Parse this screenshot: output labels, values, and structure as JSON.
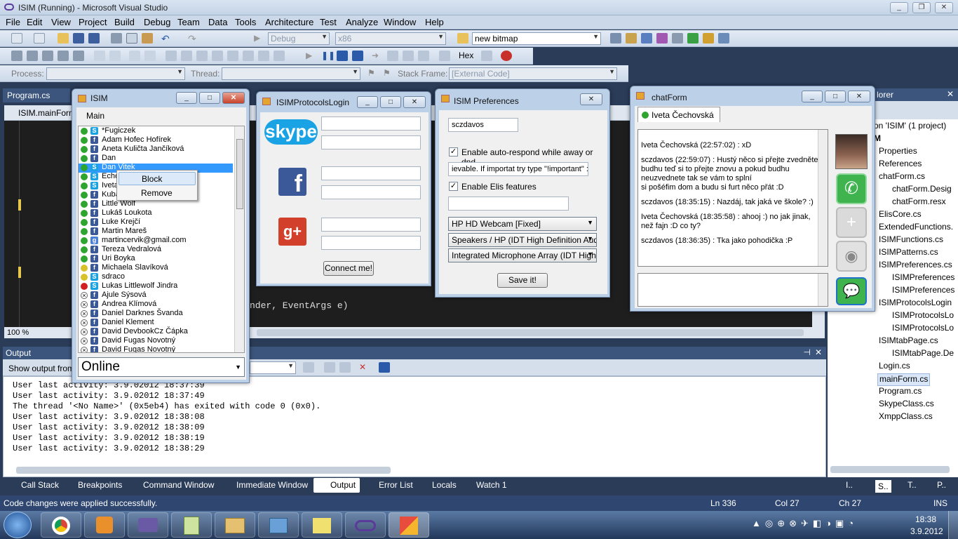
{
  "vs": {
    "title": "ISIM (Running) - Microsoft Visual Studio",
    "menu": [
      "File",
      "Edit",
      "View",
      "Project",
      "Build",
      "Debug",
      "Team",
      "Data",
      "Tools",
      "Architecture",
      "Test",
      "Analyze",
      "Window",
      "Help"
    ],
    "config": "Debug",
    "platform": "x86",
    "find": "new bitmap",
    "hex": "Hex",
    "process_label": "Process:",
    "thread_label": "Thread:",
    "stackframe_label": "Stack Frame:",
    "stackframe_value": "[External Code]",
    "doc_tab": "Program.cs",
    "doc_tab2": "ISIM.mainForm",
    "zoom": "100 %",
    "code_line1": "nder, EventArgs e)",
    "output_title": "Output",
    "show_output": "Show output from:",
    "output_lines": [
      "User last activity: 3.9.02012 18:37:39",
      "User last activity: 3.9.02012 18:37:49",
      "The thread '<No Name>' (0x5eb4) has exited with code 0 (0x0).",
      "User last activity: 3.9.02012 18:38:08",
      "User last activity: 3.9.02012 18:38:09",
      "User last activity: 3.9.02012 18:38:19",
      "User last activity: 3.9.02012 18:38:29"
    ],
    "bottom_tabs": [
      "Call Stack",
      "Breakpoints",
      "Command Window",
      "Immediate Window",
      "Output",
      "Error List",
      "Locals",
      "Watch 1"
    ],
    "right_tabs": [
      "I..",
      "S..",
      "T..",
      "P.."
    ],
    "status_msg": "Code changes were applied successfully.",
    "ln": "Ln 336",
    "col": "Col 27",
    "ch": "Ch 27",
    "ins": "INS",
    "solution_title": "lorer",
    "solution_items": [
      "on 'ISIM' (1 project)",
      "M",
      "Properties",
      "References",
      "chatForm.cs",
      "chatForm.Desig",
      "chatForm.resx",
      "ElisCore.cs",
      "ExtendedFunctions.",
      "ISIMFunctions.cs",
      "ISIMPatterns.cs",
      "ISIMPreferences.cs",
      "ISIMPreferences",
      "ISIMPreferences",
      "ISIMProtocolsLogin",
      "ISIMProtocolsLo",
      "ISIMProtocolsLo",
      "ISIMtabPage.cs",
      "ISIMtabPage.De",
      "Login.cs",
      "mainForm.cs",
      "Program.cs",
      "SkypeClass.cs",
      "XmppClass.cs"
    ]
  },
  "isim": {
    "title": "ISIM",
    "menu": "Main",
    "contacts": [
      {
        "name": "*Fugiczek",
        "status": "green",
        "svc": "skype"
      },
      {
        "name": "Adam Hofec Hofírek",
        "status": "green",
        "svc": "fb"
      },
      {
        "name": "Aneta Kuličta Jančíková",
        "status": "green",
        "svc": "fb"
      },
      {
        "name": "Dan",
        "status": "green",
        "svc": "fb"
      },
      {
        "name": "Dan Vitek",
        "status": "green",
        "svc": "skype"
      },
      {
        "name": "Echo",
        "status": "green",
        "svc": "skype"
      },
      {
        "name": "Iveta",
        "status": "green",
        "svc": "skype"
      },
      {
        "name": "Kuba",
        "status": "green",
        "svc": "fb"
      },
      {
        "name": "Little Wolf",
        "status": "green",
        "svc": "fb"
      },
      {
        "name": "Lukáš Loukota",
        "status": "green",
        "svc": "fb"
      },
      {
        "name": "Luke Krejčí",
        "status": "green",
        "svc": "fb"
      },
      {
        "name": "Martin Mareš",
        "status": "green",
        "svc": "fb"
      },
      {
        "name": "martincervik@gmail.com",
        "status": "green",
        "svc": "g"
      },
      {
        "name": "Tereza Vedralová",
        "status": "green",
        "svc": "fb"
      },
      {
        "name": "Uri Boyka",
        "status": "green",
        "svc": "fb"
      },
      {
        "name": "Michaela Slavíková",
        "status": "yellow",
        "svc": "fb"
      },
      {
        "name": "sdraco",
        "status": "yellow",
        "svc": "skype"
      },
      {
        "name": "Lukas Littlewolf Jindra",
        "status": "red",
        "svc": "skype"
      },
      {
        "name": "Ajule Sýsová",
        "status": "off",
        "svc": "fb"
      },
      {
        "name": "Andrea Klímová",
        "status": "off",
        "svc": "fb"
      },
      {
        "name": "Daniel Darknes Švanda",
        "status": "off",
        "svc": "fb"
      },
      {
        "name": "Daniel Klement",
        "status": "off",
        "svc": "fb"
      },
      {
        "name": "David DevbookCz Čápka",
        "status": "off",
        "svc": "fb"
      },
      {
        "name": "David Fugas Novotný",
        "status": "off",
        "svc": "fb"
      },
      {
        "name": "David Fugas Novotný",
        "status": "off",
        "svc": "fb"
      }
    ],
    "context_menu": [
      "Block",
      "Remove"
    ],
    "status_select": "Online"
  },
  "login": {
    "title": "ISIMProtocolsLogin",
    "skype_logo": "skype",
    "fb_logo": "f",
    "gplus_logo": "g+",
    "connect": "Connect me!"
  },
  "prefs": {
    "title": "ISIM Preferences",
    "username": "sczdavos",
    "auto_respond_label": "Enable auto-respond while away or dnd",
    "auto_respond_msg": "ievable. If importat try type \"!important\" :P",
    "elis_label": "Enable Elis features",
    "webcam": "HP HD Webcam [Fixed]",
    "speakers": "Speakers / HP (IDT High Definition Aud",
    "mic": "Integrated Microphone Array (IDT High D",
    "save": "Save it!"
  },
  "chat": {
    "title": "chatForm",
    "tab": "Iveta Čechovská",
    "messages": [
      "Iveta Čechovská (22:57:02) : xD",
      "",
      "sczdavos (22:59:07) : Hustý něco si přejte zvedněte",
      "budhu teď si to přejte znovu a pokud budhu",
      "neuzvednete tak se vám to splní",
      "si pošéfim dom a budu si furt něco přát :D",
      "",
      "sczdavos (18:35:15) : Nazdáj, tak jaká ve škole? :)",
      "",
      "Iveta Čechovská (18:35:58) : ahooj :) no jak jinak,",
      "než fajn :D co ty?",
      "",
      "sczdavos (18:36:35) : Tka jako pohodička :P"
    ]
  },
  "tray": {
    "time": "18:38",
    "date": "3.9.2012"
  }
}
